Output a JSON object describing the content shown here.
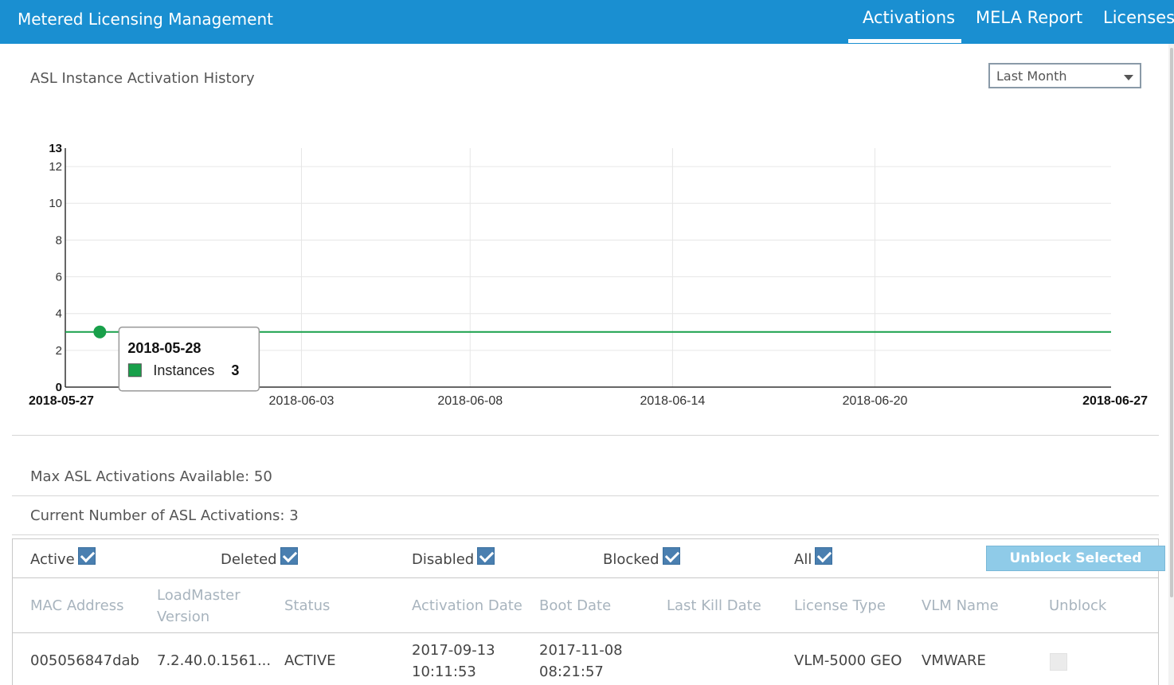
{
  "header": {
    "app_title": "Metered Licensing Management",
    "tabs": [
      {
        "label": "Activations",
        "active": true
      },
      {
        "label": "MELA Report",
        "active": false
      },
      {
        "label": "Licenses",
        "active": false
      }
    ],
    "background_color": "#1a8fd1"
  },
  "chart_section": {
    "title": "ASL Instance Activation History",
    "range_select": {
      "value": "Last Month"
    },
    "tooltip": {
      "date": "2018-05-28",
      "series": "Instances",
      "value": "3"
    }
  },
  "chart_data": {
    "type": "line",
    "title": "",
    "xlabel": "",
    "ylabel": "",
    "x_ticks": [
      "2018-05-27",
      "2018-06-03",
      "2018-06-08",
      "2018-06-14",
      "2018-06-20",
      "2018-06-27"
    ],
    "y_ticks": [
      "0",
      "2",
      "4",
      "6",
      "8",
      "10",
      "12",
      "13"
    ],
    "xlim": [
      "2018-05-27",
      "2018-06-27"
    ],
    "ylim": [
      0,
      13
    ],
    "grid": true,
    "series": [
      {
        "name": "Instances",
        "color": "#18a04a",
        "points": [
          {
            "x": "2018-05-27",
            "y": 3
          },
          {
            "x": "2018-06-27",
            "y": 3
          }
        ],
        "highlighted_point": {
          "x": "2018-05-28",
          "y": 3
        }
      }
    ]
  },
  "stats": {
    "max_activations": "Max ASL Activations Available: 50",
    "current_activations": "Current Number of ASL Activations: 3"
  },
  "filters": {
    "items": [
      {
        "label": "Active",
        "checked": true
      },
      {
        "label": "Deleted",
        "checked": true
      },
      {
        "label": "Disabled",
        "checked": true
      },
      {
        "label": "Blocked",
        "checked": true
      },
      {
        "label": "All",
        "checked": true
      }
    ],
    "unblock_button": "Unblock Selected"
  },
  "table": {
    "columns": [
      "MAC Address",
      "LoadMaster Version",
      "Status",
      "Activation Date",
      "Boot Date",
      "Last Kill Date",
      "License Type",
      "VLM Name",
      "Unblock"
    ],
    "rows": [
      {
        "mac": "005056847dab",
        "version": "7.2.40.0.1561...",
        "status": "ACTIVE",
        "activation_date": "2017-09-13",
        "activation_time": "10:11:53",
        "boot_date": "2017-11-08",
        "boot_time": "08:21:57",
        "last_kill_date": "",
        "license_type": "VLM-5000 GEO",
        "vlm_name": "VMWARE",
        "unblock_checked": false
      }
    ]
  }
}
